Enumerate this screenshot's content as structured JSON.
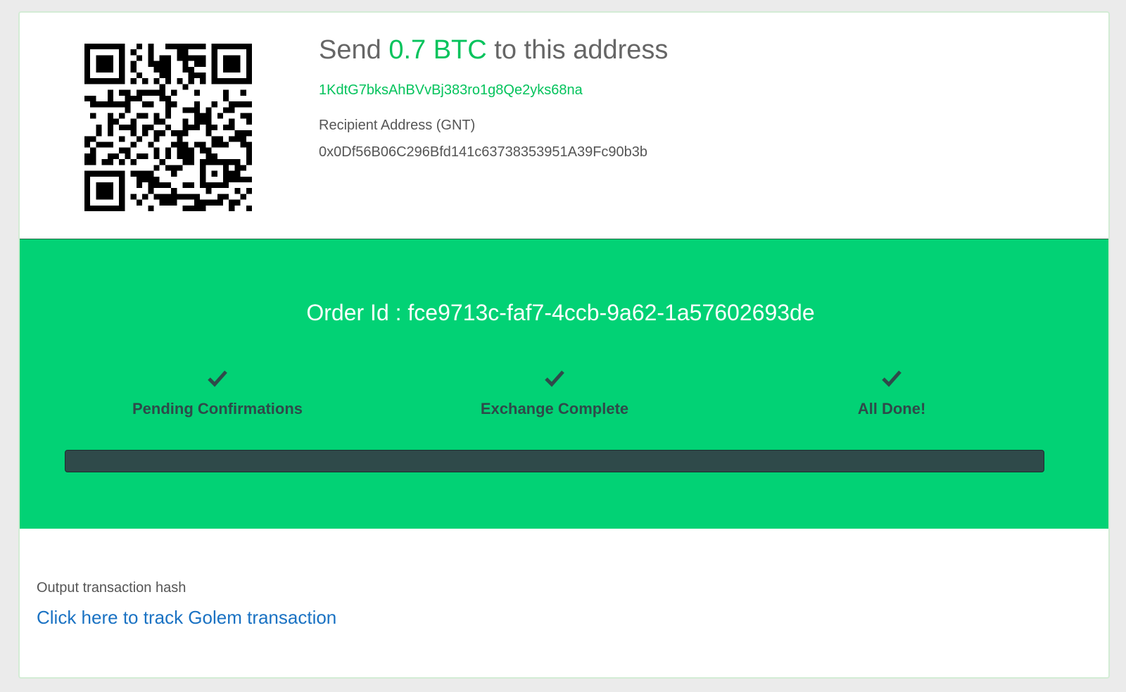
{
  "payment": {
    "send_prefix": "Send ",
    "amount": "0.7 BTC",
    "send_suffix": " to this address",
    "deposit_address": "1KdtG7bksAhBVvBj383ro1g8Qe2yks68na",
    "qr_icon": "qr-code-icon",
    "recipient_label": "Recipient Address (GNT)",
    "recipient_address": "0x0Df56B06C296Bfd141c63738353951A39Fc90b3b"
  },
  "status": {
    "order_id": "Order Id : fce9713c-faf7-4ccb-9a62-1a57602693de",
    "steps": [
      {
        "label": "Pending Confirmations",
        "icon": "check-icon",
        "done": true
      },
      {
        "label": "Exchange Complete",
        "icon": "check-icon",
        "done": true
      },
      {
        "label": "All Done!",
        "icon": "check-icon",
        "done": true
      }
    ],
    "progress_fraction": 1.0
  },
  "output": {
    "label": "Output transaction hash",
    "link_text": "Click here to track Golem transaction"
  },
  "colors": {
    "accent_green": "#04c35c",
    "panel_green": "#02d275",
    "dark_slate": "#2f4a4a",
    "link_blue": "#1a72c3"
  }
}
